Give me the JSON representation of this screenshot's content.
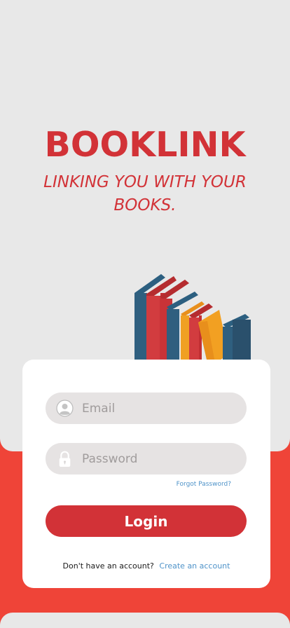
{
  "brand": {
    "title": "BOOKLINK",
    "tagline": "LINKING YOU WITH YOUR BOOKS."
  },
  "login_form": {
    "email": {
      "placeholder": "Email",
      "value": "",
      "icon": "user-circle-icon"
    },
    "password": {
      "placeholder": "Password",
      "value": "",
      "icon": "lock-icon"
    },
    "forgot_password_label": "Forgot Password?",
    "login_label": "Login",
    "signup_prompt": "Don't have an account?",
    "signup_link_label": "Create an account"
  },
  "colors": {
    "brand_red": "#d23237",
    "background_red": "#ef4438",
    "panel_gray": "#e8e8e8",
    "field_gray": "#e6e3e3",
    "link_blue": "#4f93c9"
  }
}
